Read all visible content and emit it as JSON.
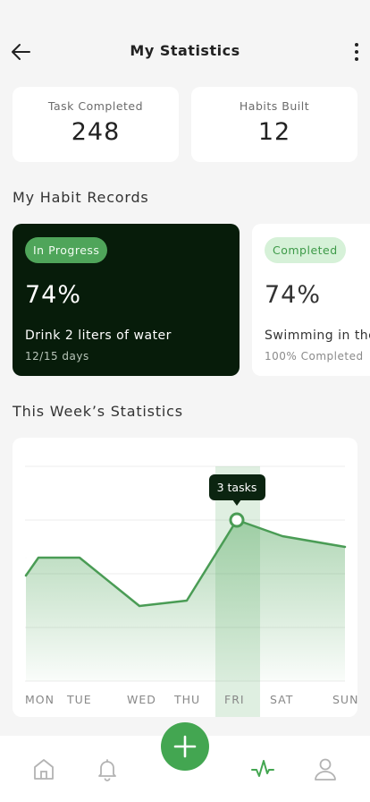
{
  "header": {
    "title": "My Statistics",
    "back_icon": "arrow-left-icon",
    "more_icon": "more-vertical-icon"
  },
  "stats": [
    {
      "label": "Task Completed",
      "value": "248"
    },
    {
      "label": "Habits Built",
      "value": "12"
    }
  ],
  "habit_section": {
    "title": "My Habit Records"
  },
  "habits": [
    {
      "badge": "In Progress",
      "percent": "74%",
      "name": "Drink 2 liters of water",
      "sub": "12/15 days"
    },
    {
      "badge": "Completed",
      "percent": "74%",
      "name": "Swimming in the",
      "sub": "100% Completed"
    }
  ],
  "week_section": {
    "title": "This Week’s Statistics"
  },
  "chart_data": {
    "type": "area",
    "categories": [
      "MON",
      "TUE",
      "WED",
      "THU",
      "FRI",
      "SAT",
      "SUN"
    ],
    "values": [
      2.3,
      2.3,
      1.4,
      1.5,
      3,
      2.7,
      2.5
    ],
    "ylim": [
      0,
      4
    ],
    "highlight": {
      "category": "FRI",
      "label": "3 tasks"
    },
    "grid": true,
    "color": "#4a9c55"
  },
  "nav": {
    "items": [
      {
        "icon": "home-icon"
      },
      {
        "icon": "bell-icon"
      },
      {
        "icon": "add-icon"
      },
      {
        "icon": "activity-icon"
      },
      {
        "icon": "user-icon"
      }
    ],
    "accent": "#43a651"
  }
}
